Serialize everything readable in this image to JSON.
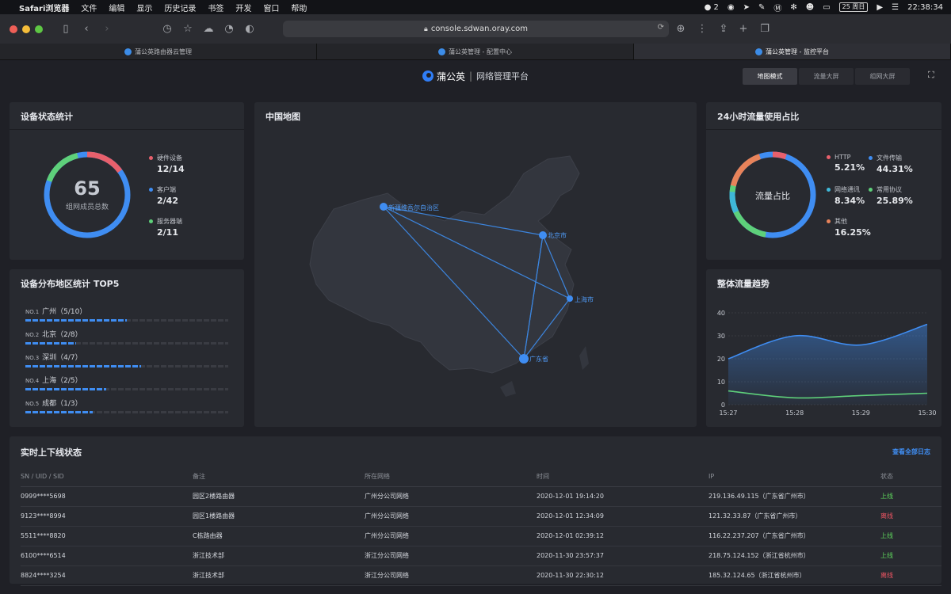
{
  "menubar": {
    "app": "Safari浏览器",
    "items": [
      "文件",
      "编辑",
      "显示",
      "历史记录",
      "书签",
      "开发",
      "窗口",
      "帮助"
    ],
    "badge": "2",
    "date": "25 周日",
    "time": "22:38:34"
  },
  "browser": {
    "url": "console.sdwan.oray.com",
    "tabs": [
      {
        "label": "蒲公英路由器云管理"
      },
      {
        "label": "蒲公英管理 - 配置中心"
      },
      {
        "label": "蒲公英管理 - 监控平台"
      }
    ]
  },
  "header": {
    "brand": "蒲公英",
    "subtitle": "网络管理平台",
    "modes": [
      "地图模式",
      "流量大屏",
      "组网大屏"
    ]
  },
  "device_stats": {
    "title": "设备状态统计",
    "total": "65",
    "total_label": "组网成员总数",
    "legend": [
      {
        "name": "硬件设备",
        "value": "12/14",
        "color": "#e8606c"
      },
      {
        "name": "客户端",
        "value": "2/42",
        "color": "#3f8df2"
      },
      {
        "name": "服务器端",
        "value": "2/11",
        "color": "#5ed07a"
      }
    ]
  },
  "region_top5": {
    "title": "设备分布地区统计 TOP5",
    "rows": [
      {
        "no": "NO.1",
        "city": "广州",
        "count": "（5/10）",
        "ratio": 0.5
      },
      {
        "no": "NO.2",
        "city": "北京",
        "count": "（2/8）",
        "ratio": 0.25
      },
      {
        "no": "NO.3",
        "city": "深圳",
        "count": "（4/7）",
        "ratio": 0.571
      },
      {
        "no": "NO.4",
        "city": "上海",
        "count": "（2/5）",
        "ratio": 0.4
      },
      {
        "no": "NO.5",
        "city": "成都",
        "count": "（1/3）",
        "ratio": 0.333
      }
    ]
  },
  "map": {
    "title": "中国地图",
    "cities": [
      "新疆维吾尔自治区",
      "北京市",
      "上海市",
      "广东省"
    ]
  },
  "traffic_share": {
    "title": "24小时流量使用占比",
    "center": "流量占比",
    "legend": [
      {
        "name": "HTTP",
        "value": "5.21%",
        "color": "#e8606c"
      },
      {
        "name": "文件传输",
        "value": "44.31%",
        "color": "#3f8df2"
      },
      {
        "name": "网络通讯",
        "value": "8.34%",
        "color": "#3fb8d8"
      },
      {
        "name": "常用协议",
        "value": "25.89%",
        "color": "#5ed07a"
      },
      {
        "name": "其他",
        "value": "16.25%",
        "color": "#e8835a"
      }
    ]
  },
  "trend": {
    "title": "整体流量趋势"
  },
  "chart_data": {
    "type": "area",
    "x": [
      "15:27",
      "15:28",
      "15:29",
      "15:30"
    ],
    "yticks": [
      "0",
      "10",
      "20",
      "30",
      "40"
    ],
    "ylim": [
      0,
      40
    ],
    "series": [
      {
        "values": [
          20,
          30,
          26,
          35
        ],
        "color": "#3f8df2"
      },
      {
        "values": [
          6,
          3,
          4,
          5
        ],
        "color": "#5ed07a"
      }
    ]
  },
  "status_table": {
    "title": "实时上下线状态",
    "view_all": "查看全部日志",
    "columns": [
      "SN / UID / SID",
      "备注",
      "所在网络",
      "时间",
      "IP",
      "状态"
    ],
    "rows": [
      {
        "sn": "0999****5698",
        "note": "园区2楼路由器",
        "network": "广州分公司网络",
        "time": "2020-12-01 19:14:20",
        "ip": "219.136.49.115（广东省广州市）",
        "status": "上线",
        "online": true
      },
      {
        "sn": "9123****8994",
        "note": "园区1楼路由器",
        "network": "广州分公司网络",
        "time": "2020-12-01 12:34:09",
        "ip": "121.32.33.87（广东省广州市）",
        "status": "离线",
        "online": false
      },
      {
        "sn": "5511****8820",
        "note": "C栋路由器",
        "network": "广州分公司网络",
        "time": "2020-12-01 02:39:12",
        "ip": "116.22.237.207（广东省广州市）",
        "status": "上线",
        "online": true
      },
      {
        "sn": "6100****6514",
        "note": "浙江技术部",
        "network": "浙江分公司网络",
        "time": "2020-11-30 23:57:37",
        "ip": "218.75.124.152（浙江省杭州市）",
        "status": "上线",
        "online": true
      },
      {
        "sn": "8824****3254",
        "note": "浙江技术部",
        "network": "浙江分公司网络",
        "time": "2020-11-30 22:30:12",
        "ip": "185.32.124.65（浙江省杭州市）",
        "status": "离线",
        "online": false
      }
    ]
  }
}
